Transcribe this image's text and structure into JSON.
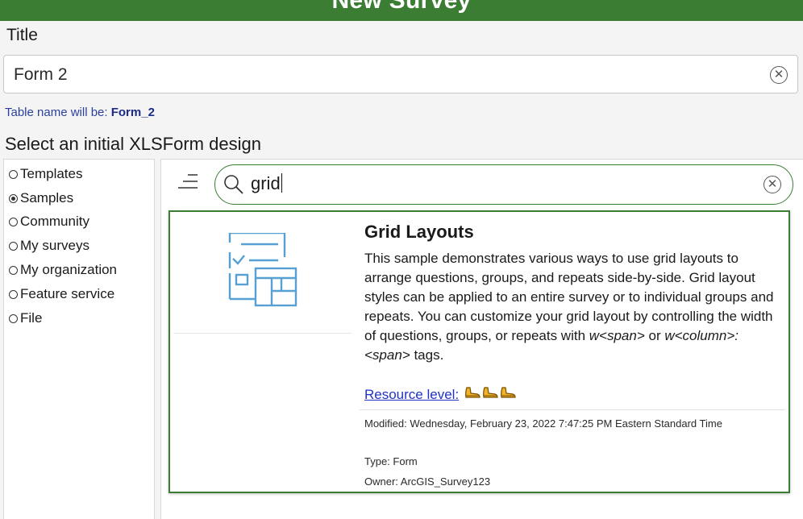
{
  "header": {
    "title": "New Survey"
  },
  "title_field": {
    "label": "Title",
    "value": "Form 2"
  },
  "table_name": {
    "prefix": "Table name will be: ",
    "value": "Form_2"
  },
  "design": {
    "label": "Select an initial XLSForm design",
    "options": [
      {
        "label": "Templates",
        "selected": false
      },
      {
        "label": "Samples",
        "selected": true
      },
      {
        "label": "Community",
        "selected": false
      },
      {
        "label": "My surveys",
        "selected": false
      },
      {
        "label": "My organization",
        "selected": false
      },
      {
        "label": "Feature service",
        "selected": false
      },
      {
        "label": "File",
        "selected": false
      }
    ]
  },
  "search": {
    "value": "grid"
  },
  "card": {
    "title": "Grid Layouts",
    "description": {
      "part1": "This sample demonstrates various ways to use grid layouts to arrange questions, groups, and repeats side-by-side. Grid layout styles can be applied to an entire survey or to individual groups and repeats. You can customize your grid layout by controlling the width of questions, groups, or repeats with ",
      "code1": "w<span>",
      "part2": " or ",
      "code2": "w<column>:<span>",
      "part3": " tags."
    },
    "resource_level_label": "Resource level:",
    "resource_level_value": 3,
    "modified": "Modified: Wednesday, February 23, 2022 7:47:25 PM Eastern Standard Time",
    "type": "Type: Form",
    "owner": "Owner: ArcGIS_Survey123"
  },
  "icons": {
    "clear": "clear-circle-icon",
    "search": "search-icon",
    "filter": "filter-lines-icon",
    "resource": "shoe-icon",
    "thumbnail": "grid-form-icon"
  },
  "colors": {
    "brand_green": "#3a7d33",
    "link_blue": "#1f33c4",
    "table_name_blue": "#2b3f9e",
    "thumbnail_blue": "#56a0d3"
  }
}
